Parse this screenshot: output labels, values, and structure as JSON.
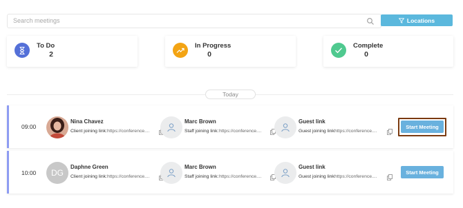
{
  "search": {
    "placeholder": "Search meetings"
  },
  "locations_button": {
    "label": "Locations"
  },
  "stats": [
    {
      "label": "To Do",
      "count": "2",
      "color": "#5470d8",
      "icon": "hourglass-icon"
    },
    {
      "label": "In Progress",
      "count": "0",
      "color": "#f3a414",
      "icon": "trend-up-icon"
    },
    {
      "label": "Complete",
      "count": "0",
      "color": "#4fc98f",
      "icon": "check-icon"
    }
  ],
  "day_label": "Today",
  "meetings": [
    {
      "time": "09:00",
      "client": {
        "name": "Nina Chavez",
        "link_label": "Client joining link:",
        "link_url": "https://conference...."
      },
      "staff": {
        "name": "Marc Brown",
        "link_label": "Staff joining link:",
        "link_url": "https://conference...."
      },
      "guest": {
        "name": "Guest link",
        "link_label": "Guest joining link:",
        "link_url": "https://conference...."
      },
      "button": "Start Meeting"
    },
    {
      "time": "10:00",
      "client": {
        "name": "Daphne Green",
        "initials": "DG",
        "link_label": "Client joining link:",
        "link_url": "https://conference...."
      },
      "staff": {
        "name": "Marc Brown",
        "link_label": "Staff joining link:",
        "link_url": "https://conference...."
      },
      "guest": {
        "name": "Guest link",
        "link_label": "Guest joining link:",
        "link_url": "https://conference...."
      },
      "button": "Start Meeting"
    }
  ],
  "colors": {
    "accent": "#5bb8dd",
    "row_accent": "#8e9cf2",
    "button": "#69b1de"
  }
}
